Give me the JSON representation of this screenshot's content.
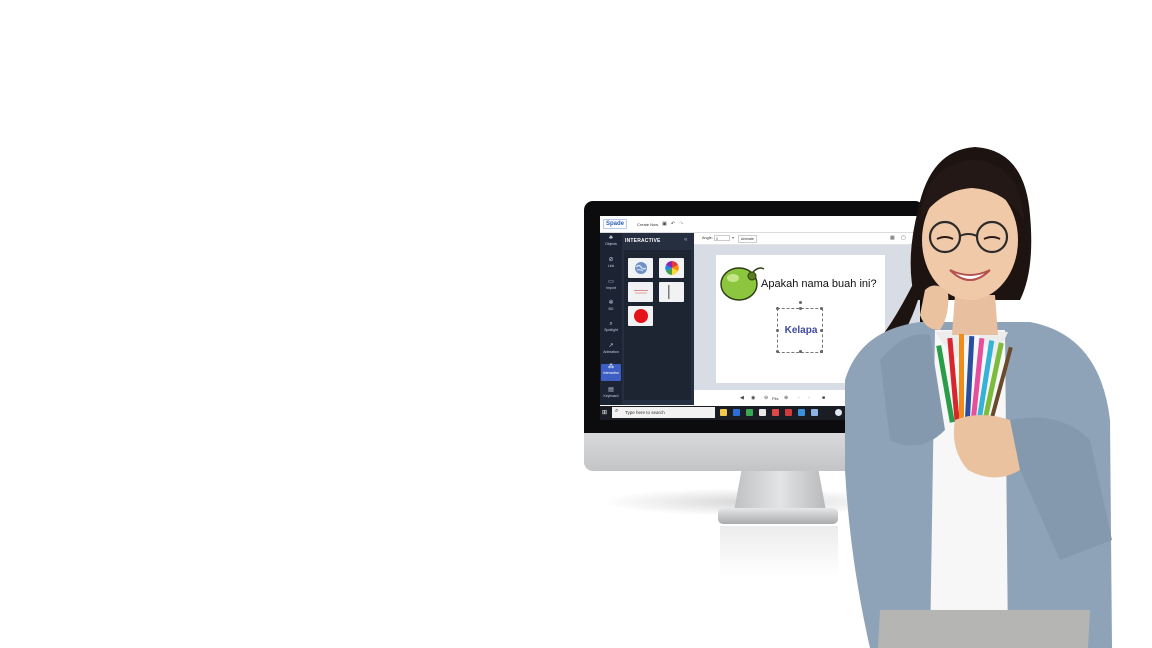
{
  "app": {
    "logo_text": "Spade",
    "create_now_label": "Create Now"
  },
  "sidebar": {
    "items": [
      {
        "label": "Objects",
        "icon": "objects-icon"
      },
      {
        "label": "Link",
        "icon": "link-icon"
      },
      {
        "label": "Import",
        "icon": "import-icon"
      },
      {
        "label": "BG",
        "icon": "background-icon"
      },
      {
        "label": "Spotlight",
        "icon": "spotlight-icon"
      },
      {
        "label": "Animation",
        "icon": "animation-icon"
      },
      {
        "label": "Interactive",
        "icon": "interactive-icon",
        "active": true
      },
      {
        "label": "Keyboard",
        "icon": "keyboard-icon"
      }
    ]
  },
  "panel": {
    "title": "INTERACTIVE",
    "tiles": [
      "globe-widget",
      "color-wheel-widget",
      "text-widget",
      "slider-widget",
      "record-button-widget"
    ]
  },
  "toolbar": {
    "angle_label": "Angle:",
    "angle_value": "0",
    "animate_label": "Animate"
  },
  "slide": {
    "question": "Apakah nama buah ini?",
    "answer": "Kelapa"
  },
  "playbar": {
    "fit_label": "Fits"
  },
  "taskbar": {
    "search_placeholder": "Type here to search"
  },
  "colors": {
    "accent": "#3d5fc4",
    "sidebar_bg": "#1c2434",
    "panel_bg": "#262f40",
    "answer_text": "#3f4a9c"
  }
}
